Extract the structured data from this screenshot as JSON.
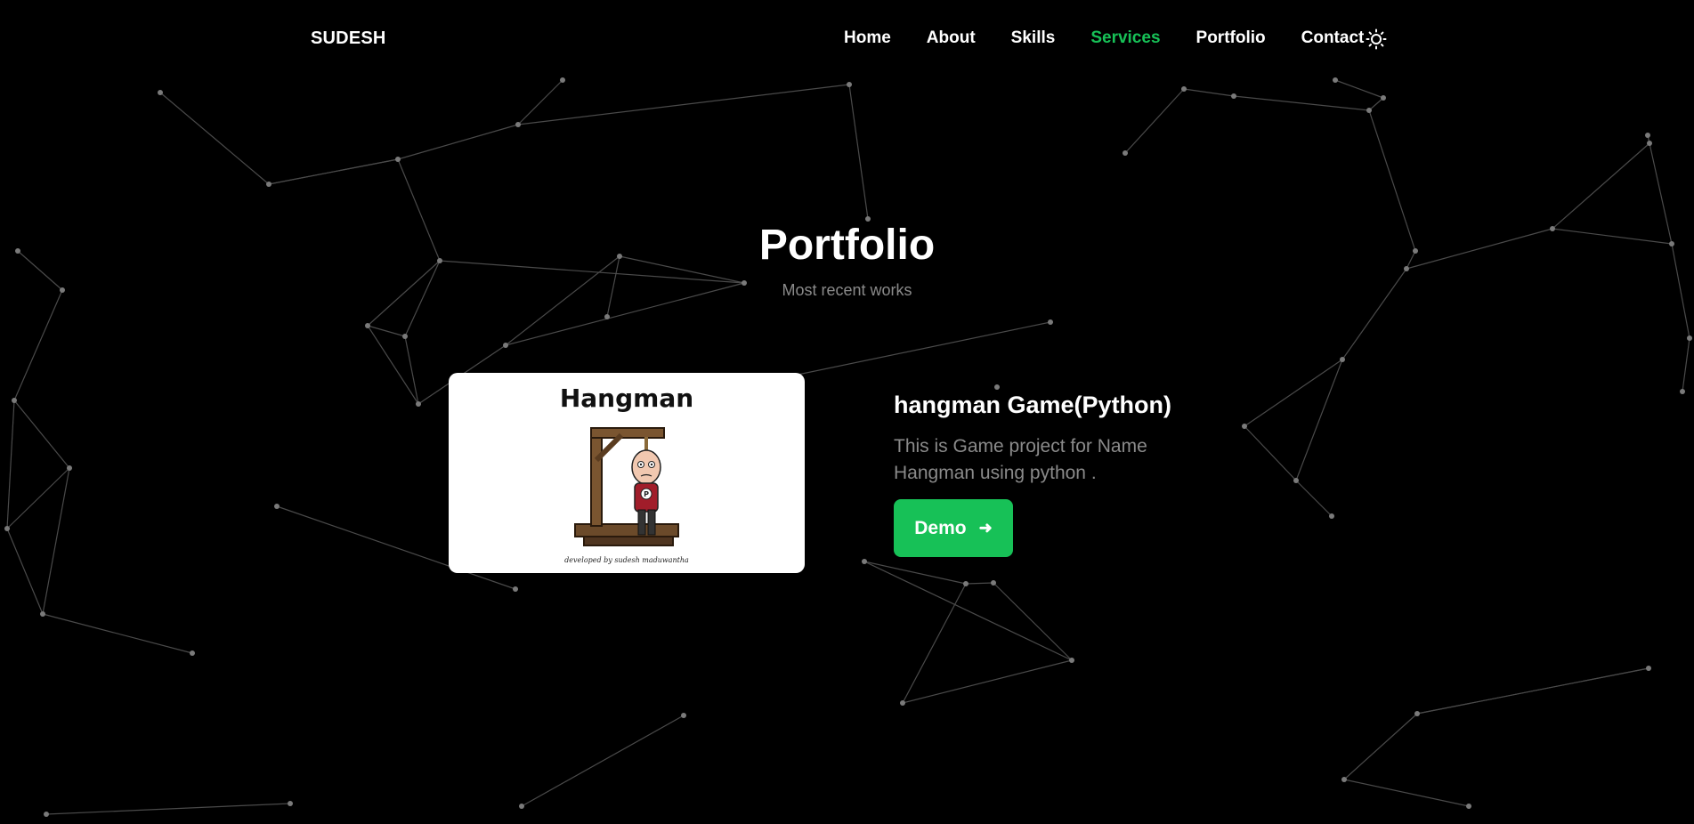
{
  "header": {
    "logo": "SUDESH",
    "nav": [
      {
        "label": "Home",
        "active": false
      },
      {
        "label": "About",
        "active": false
      },
      {
        "label": "Skills",
        "active": false
      },
      {
        "label": "Services",
        "active": true
      },
      {
        "label": "Portfolio",
        "active": false
      },
      {
        "label": "Contact",
        "active": false
      }
    ],
    "theme_toggle_icon": "sun-icon"
  },
  "portfolio": {
    "title": "Portfolio",
    "subtitle": "Most recent works",
    "project": {
      "image": {
        "title": "Hangman",
        "credit": "developed by sudesh maduwantha",
        "illustration": "hangman-gallows-figure"
      },
      "title": "hangman Game(Python)",
      "description": "This is Game project for Name Hangman using python .",
      "demo_label": "Demo",
      "demo_icon": "arrow-right-icon"
    }
  },
  "colors": {
    "background": "#000000",
    "accent": "#17c157",
    "muted_text": "#8a8a8a"
  }
}
